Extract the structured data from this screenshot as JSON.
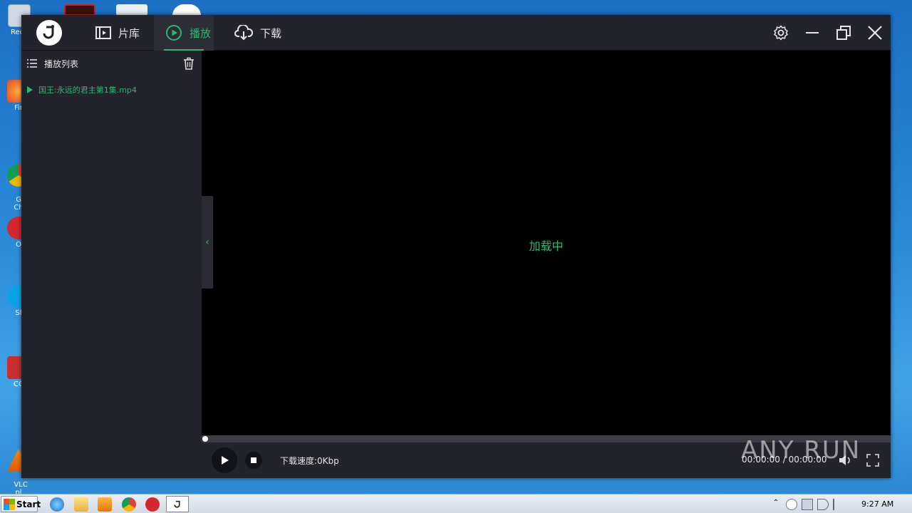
{
  "desktop": {
    "icons": [
      {
        "label": "Recy"
      },
      {
        "label": "Fir"
      },
      {
        "label": "Go\nCh"
      },
      {
        "label": "O"
      },
      {
        "label": "Sl"
      },
      {
        "label": "CC"
      },
      {
        "label": "VLC\npl"
      }
    ]
  },
  "app": {
    "tabs": [
      {
        "label": "片库",
        "icon": "library-icon"
      },
      {
        "label": "播放",
        "icon": "play-circle-icon"
      },
      {
        "label": "下载",
        "icon": "cloud-download-icon"
      }
    ],
    "active_tab": "播放",
    "accent_color": "#2bb673",
    "sidebar": {
      "header": "播放列表",
      "playlist": [
        "国王:永远的君主第1集.mp4"
      ]
    },
    "player": {
      "status": "加载中",
      "speed": "下载速度:0Kbp",
      "time": "00:00:00 / 00:00:00",
      "progress": 0
    }
  },
  "watermark": "ANY RUN",
  "taskbar": {
    "start_label": "Start",
    "clock": "9:27 AM"
  }
}
